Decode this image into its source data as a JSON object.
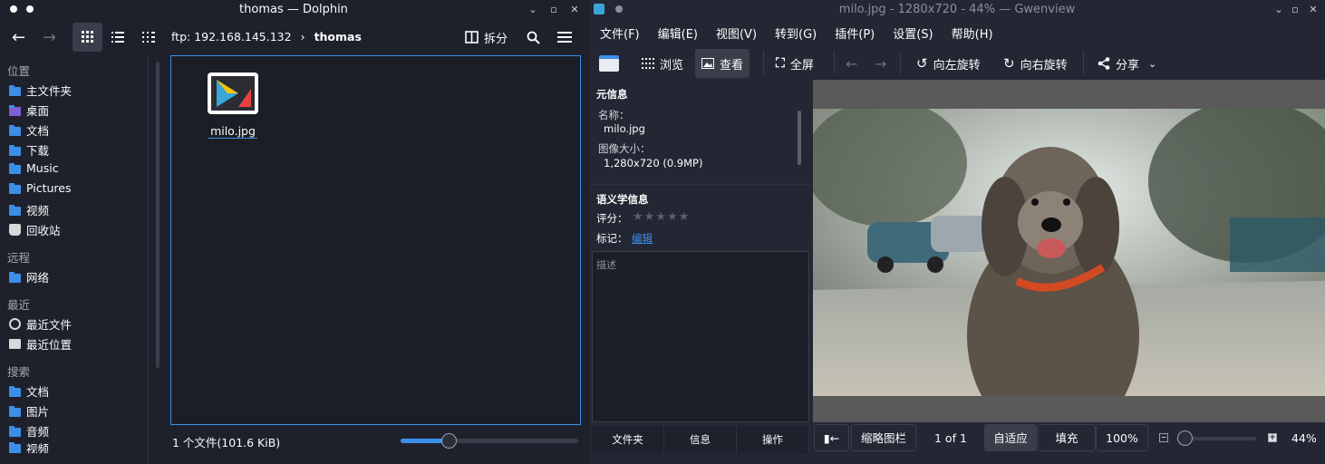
{
  "dolphin": {
    "title": "thomas — Dolphin",
    "path_host": "ftp: 192.168.145.132",
    "path_folder": "thomas",
    "split_label": "拆分",
    "sidebar": {
      "places_title": "位置",
      "places": [
        "主文件夹",
        "桌面",
        "文档",
        "下载",
        "Music",
        "Pictures",
        "视频",
        "回收站"
      ],
      "remote_title": "远程",
      "remote": [
        "网络"
      ],
      "recent_title": "最近",
      "recent": [
        "最近文件",
        "最近位置"
      ],
      "search_title": "搜索",
      "search": [
        "文档",
        "图片",
        "音频",
        "视频"
      ]
    },
    "file": {
      "name": "milo.jpg"
    },
    "status": "1 个文件(101.6 KiB)",
    "zoom_level": 0.27
  },
  "gwenview": {
    "title": "milo.jpg - 1280x720 - 44% — Gwenview",
    "menus": [
      "文件(F)",
      "编辑(E)",
      "视图(V)",
      "转到(G)",
      "插件(P)",
      "设置(S)",
      "帮助(H)"
    ],
    "toolbar": {
      "browse": "浏览",
      "view": "查看",
      "fullscreen": "全屏",
      "rotate_left": "向左旋转",
      "rotate_right": "向右旋转",
      "share": "分享"
    },
    "meta": {
      "title": "元信息",
      "name_label": "名称：",
      "name_value": "milo.jpg",
      "size_label": "图像大小：",
      "size_value": "1,280x720 (0.9MP)"
    },
    "semantic": {
      "title": "语义学信息",
      "rating_label": "评分：",
      "stars": "★★★★★",
      "rating": 0,
      "tags_label": "标记：",
      "tags_link": "编辑",
      "description_placeholder": "描述"
    },
    "tabs": [
      "文件夹",
      "信息",
      "操作"
    ],
    "bottom": {
      "thumb_label": "缩略图栏",
      "page": "1 of 1",
      "fit": "自适应",
      "fill": "填充",
      "hundred": "100%",
      "zoom": "44%",
      "zoom_level": 0.1
    }
  }
}
